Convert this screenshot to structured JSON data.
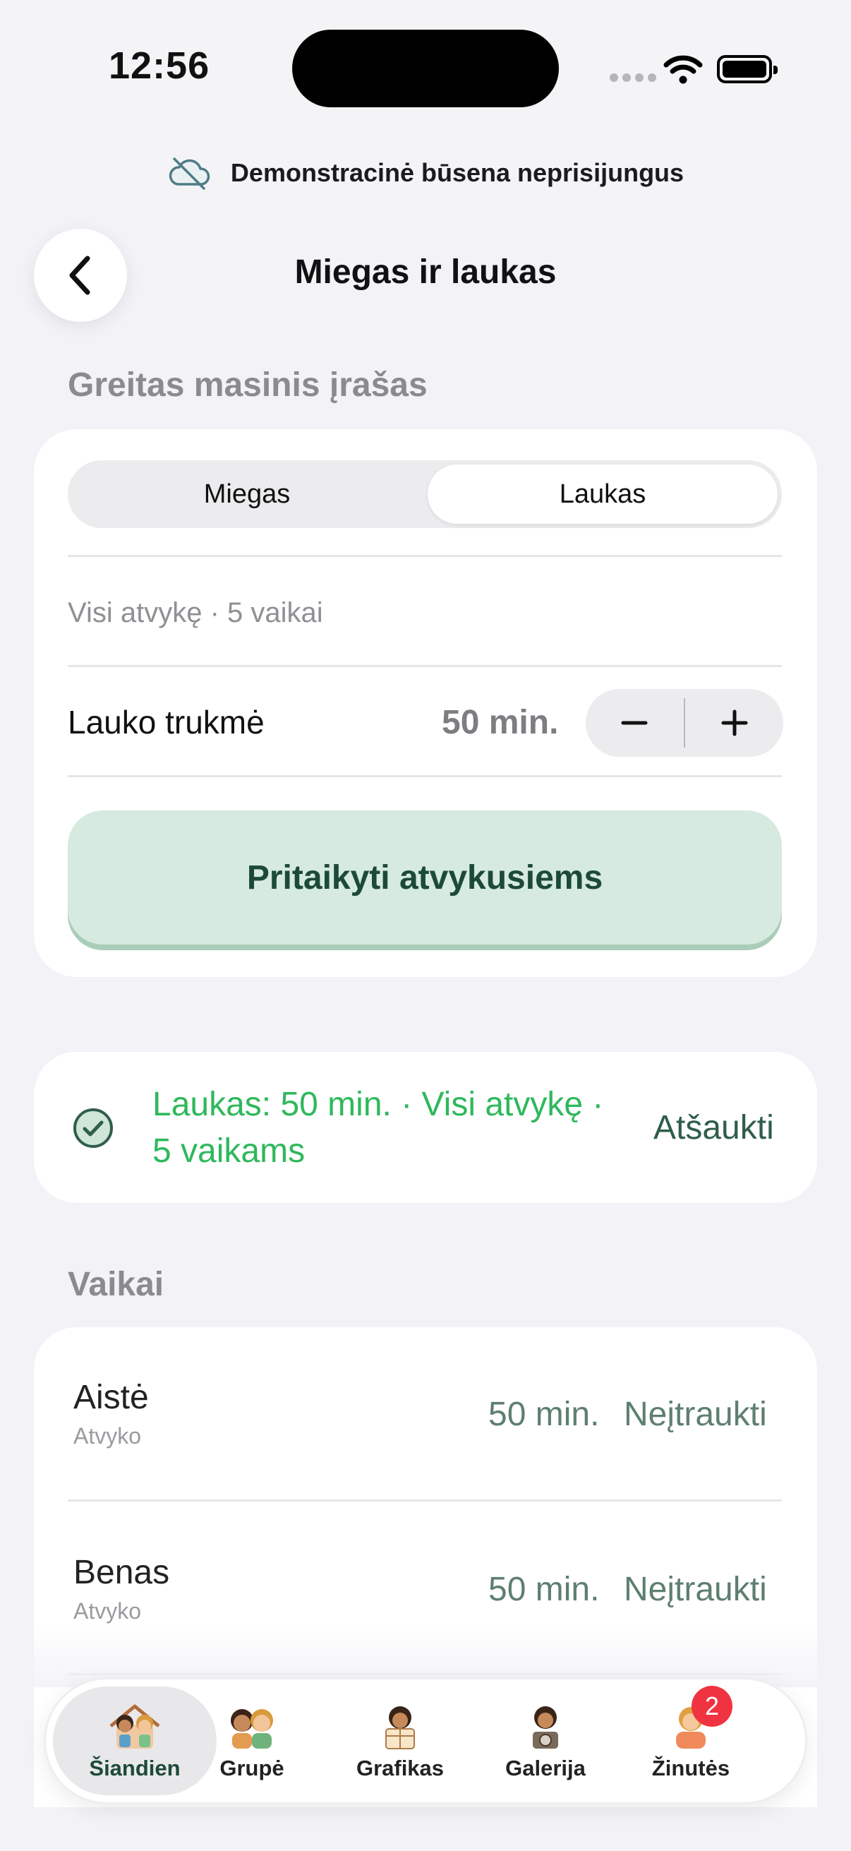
{
  "status": {
    "time": "12:56"
  },
  "banner": {
    "text": "Demonstracinė būsena neprisijungus",
    "icon": "cloud-off-icon"
  },
  "header": {
    "title": "Miegas ir laukas",
    "back_icon": "chevron-left-icon"
  },
  "bulk": {
    "section_label": "Greitas masinis įrašas",
    "tabs": [
      {
        "label": "Miegas",
        "active": false
      },
      {
        "label": "Laukas",
        "active": true
      }
    ],
    "scope_text": "Visi atvykę · 5 vaikai",
    "duration_label": "Lauko trukmė",
    "duration_value": "50 min.",
    "minus": "−",
    "plus": "+",
    "apply_label": "Pritaikyti atvykusiems"
  },
  "confirmation": {
    "line1": "Laukas: 50 min. · Visi atvykę ·",
    "line2": "5 vaikams",
    "undo_label": "Atšaukti",
    "icon": "check-circle-icon"
  },
  "children": {
    "section_label": "Vaikai",
    "items": [
      {
        "name": "Aistė",
        "status": "Atvyko",
        "value": "50 min.",
        "action": "Neįtraukti"
      },
      {
        "name": "Benas",
        "status": "Atvyko",
        "value": "50 min.",
        "action": "Neįtraukti"
      }
    ]
  },
  "tabbar": {
    "items": [
      {
        "label": "Šiandien",
        "active": true
      },
      {
        "label": "Grupė",
        "active": false
      },
      {
        "label": "Grafikas",
        "active": false
      },
      {
        "label": "Galerija",
        "active": false
      },
      {
        "label": "Žinutės",
        "active": false
      }
    ],
    "messages_badge": "2"
  },
  "colors": {
    "accent": "#2eb85c",
    "apply_bg": "#d6eadf",
    "apply_text": "#1d4a38",
    "badge": "#ef3340"
  }
}
